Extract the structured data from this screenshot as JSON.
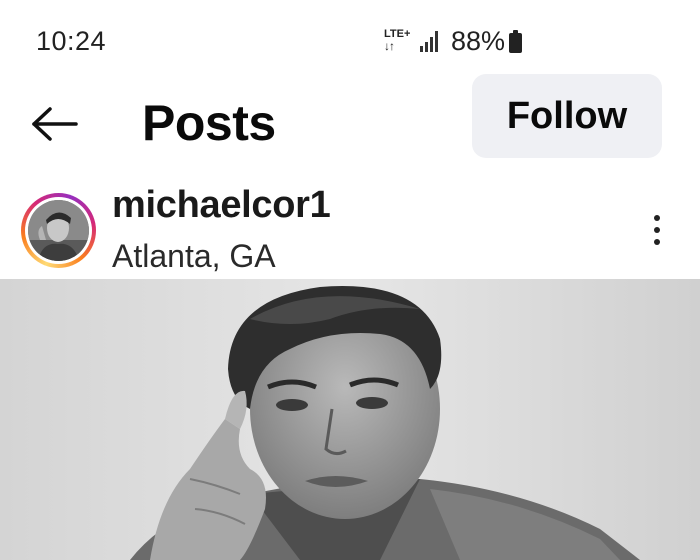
{
  "status_bar": {
    "time": "10:24",
    "network": "LTE+",
    "network_arrows": "↓↑",
    "battery_percent": "88%",
    "battery_level": 0.88,
    "signal_icon": "signal-bars-icon",
    "battery_icon": "battery-icon"
  },
  "header": {
    "title": "Posts",
    "follow_label": "Follow",
    "back_icon": "back-arrow-icon"
  },
  "post": {
    "username": "michaelcor1",
    "location": "Atlanta, GA",
    "more_icon": "more-vertical-icon",
    "image_icon": "post-photo"
  },
  "colors": {
    "follow_button_bg": "#eff0f4",
    "story_ring_start": "#feda75",
    "story_ring_end": "#962fbf"
  }
}
